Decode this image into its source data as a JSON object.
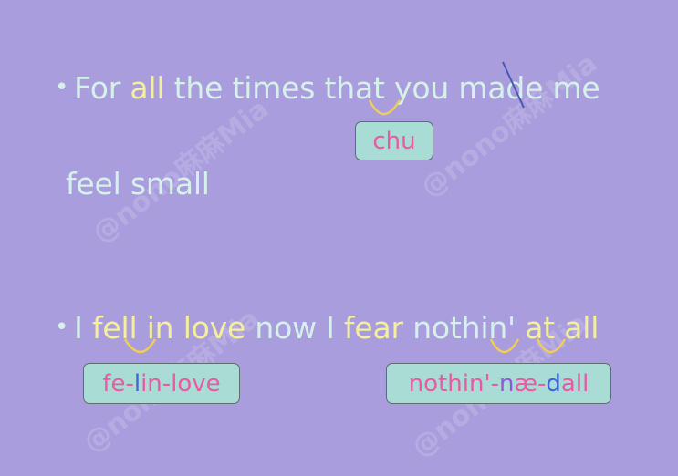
{
  "colors": {
    "background": "#a99ddd",
    "text": "#d6f1ea",
    "highlight": "#f4ef9c",
    "box_bg": "#a8dcd5",
    "box_text": "#e85aa3",
    "accent_blue": "#3f62d8",
    "accent_purple": "#8f58dc",
    "link_arc": "#f0cc5a",
    "slash": "#4a55b5"
  },
  "line1": {
    "bullet": "•",
    "segments": [
      {
        "text": "For ",
        "style": "plain"
      },
      {
        "text": "all",
        "style": "hl"
      },
      {
        "text": " the times that you made me",
        "style": "plain"
      }
    ]
  },
  "line2": {
    "text": "feel small"
  },
  "line3": {
    "bullet": "•",
    "segments": [
      {
        "text": "I ",
        "style": "plain"
      },
      {
        "text": "fell in love",
        "style": "hl"
      },
      {
        "text": " now I ",
        "style": "plain"
      },
      {
        "text": "fear",
        "style": "hl"
      },
      {
        "text": " nothin' ",
        "style": "plain"
      },
      {
        "text": "at all",
        "style": "hl"
      }
    ]
  },
  "box_chu": {
    "parts": [
      {
        "text": "chu",
        "tone": "pink"
      }
    ]
  },
  "box_fellinlove": {
    "parts": [
      {
        "text": "fe-",
        "tone": "pink"
      },
      {
        "text": "l",
        "tone": "blue"
      },
      {
        "text": "in-love",
        "tone": "pink"
      }
    ]
  },
  "box_nothin": {
    "parts": [
      {
        "text": "nothin'-",
        "tone": "pink"
      },
      {
        "text": "n",
        "tone": "purple"
      },
      {
        "text": "æ-",
        "tone": "pink"
      },
      {
        "text": "d",
        "tone": "blue"
      },
      {
        "text": "all",
        "tone": "pink"
      }
    ]
  },
  "watermark": {
    "text": "@nono麻麻Mia"
  }
}
